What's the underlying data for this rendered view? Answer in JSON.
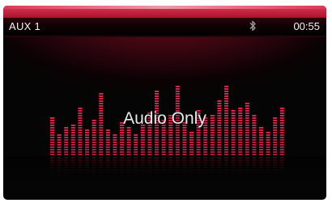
{
  "status_bar": {
    "source": "AUX 1",
    "bluetooth_icon": "bluetooth-icon",
    "time": "00:55"
  },
  "main": {
    "message": "Audio Only"
  },
  "equalizer": {
    "color": "#e0234a",
    "levels": [
      0.52,
      0.3,
      0.38,
      0.43,
      0.63,
      0.37,
      0.48,
      0.83,
      0.36,
      0.3,
      0.44,
      0.4,
      0.29,
      0.42,
      0.58,
      0.88,
      0.47,
      0.55,
      0.95,
      0.46,
      0.33,
      0.61,
      0.53,
      0.56,
      0.75,
      0.94,
      0.62,
      0.66,
      0.72,
      0.56,
      0.4,
      0.33,
      0.53,
      0.66
    ]
  },
  "colors": {
    "accent": "#b0142e",
    "text": "#f2f2f2"
  }
}
